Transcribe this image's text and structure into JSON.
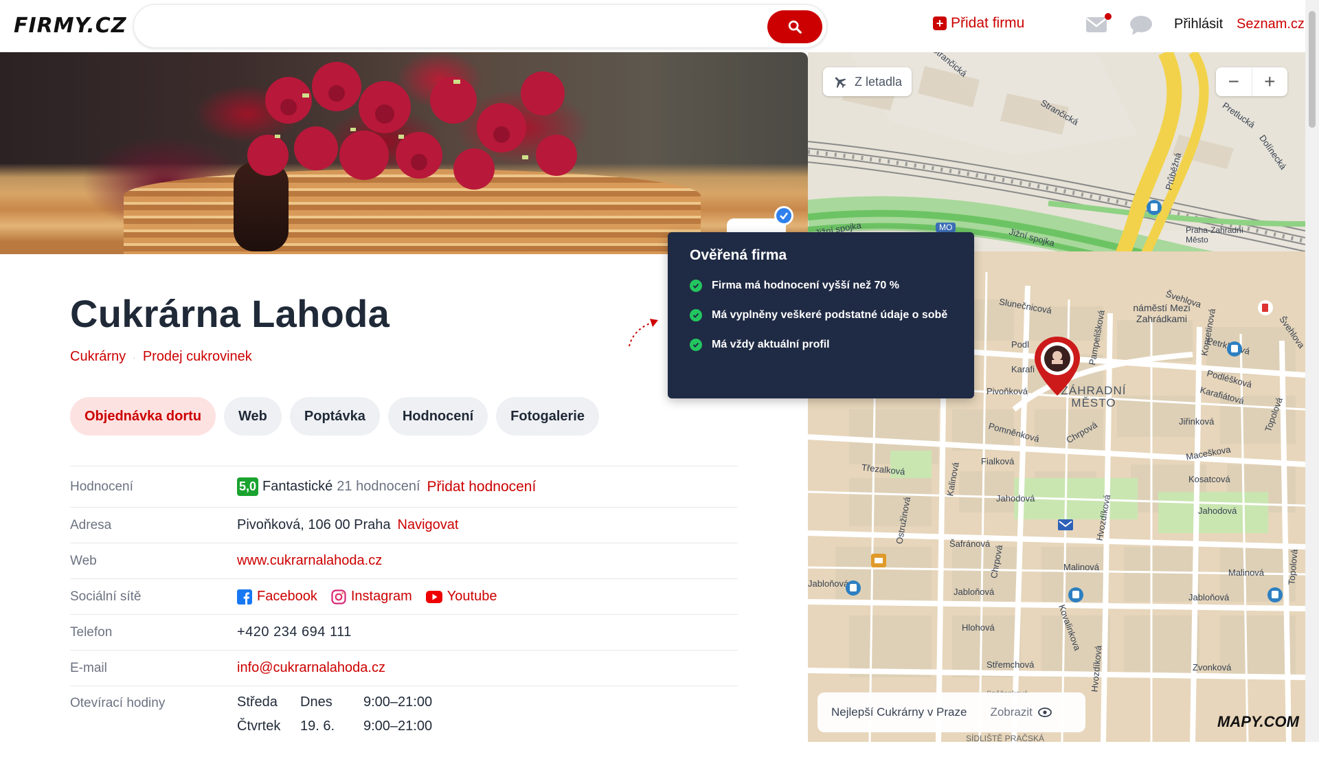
{
  "header": {
    "logo": "FIRMY.CZ",
    "search_placeholder": "",
    "add_firm": "Přidat firmu",
    "login": "Přihlásit",
    "seznam": "Seznam.cz"
  },
  "company": {
    "name": "Cukrárna Lahoda",
    "categories": [
      "Cukrárny",
      "Prodej cukrovinek"
    ]
  },
  "chips": [
    "Objednávka dortu",
    "Web",
    "Poptávka",
    "Hodnocení",
    "Fotogalerie"
  ],
  "info": {
    "rating_label": "Hodnocení",
    "rating_score": "5,0",
    "rating_word": "Fantastické",
    "rating_count": "21 hodnocení",
    "rating_add": "Přidat hodnocení",
    "address_label": "Adresa",
    "address": "Pivoňková, 106 00 Praha",
    "navigate": "Navigovat",
    "web_label": "Web",
    "web": "www.cukrarnalahoda.cz",
    "social_label": "Sociální sítě",
    "facebook": "Facebook",
    "instagram": "Instagram",
    "youtube": "Youtube",
    "phone_label": "Telefon",
    "phone": "+420 234 694 111",
    "email_label": "E-mail",
    "email": "info@cukrarnalahoda.cz",
    "hours_label": "Otevírací hodiny",
    "hours": [
      {
        "day": "Středa",
        "when": "Dnes",
        "time": "9:00–21:00"
      },
      {
        "day": "Čtvrtek",
        "when": "19. 6.",
        "time": "9:00–21:00"
      }
    ]
  },
  "tooltip": {
    "title": "Ověřená firma",
    "items": [
      "Firma má hodnocení vyšší než 70 %",
      "Má vyplněny veškeré podstatné údaje o sobě",
      "Má vždy aktuální profil"
    ]
  },
  "map": {
    "aerial_button": "Z letadla",
    "zoom_out": "−",
    "zoom_in": "+",
    "bottom_title": "Nejlepší Cukrárny v Praze",
    "bottom_show": "Zobrazit",
    "district": "ZÁHRADNÍ MĚSTO",
    "district_line1": "ZÁHRADNÍ",
    "district_line2": "MĚSTO",
    "logo": "MAPY.COM",
    "streets": [
      "Strančická",
      "Strančická",
      "Pretlucká",
      "Dolínecká",
      "Průběžná",
      "Jižní spojka",
      "Jižní spojka",
      "MO",
      "Praha-Zahradní Město",
      "Slunečnicová",
      "Pampelišková",
      "náměstí Mezi Zahrádkami",
      "Švehlova",
      "Švehlova",
      "Petrklíčová",
      "Podléšková",
      "Karafiátová",
      "Kopretinová",
      "Pivoňková",
      "Pomněnková",
      "Chrpová",
      "Jiřinková",
      "Topolová",
      "Maceškova",
      "Třezalková",
      "Fialková",
      "Kosatcová",
      "Kalinová",
      "Jahodová",
      "Jahodová",
      "Ostružinová",
      "Šafránová",
      "Chrpová",
      "Hvozdíková",
      "Malinová",
      "Malinová",
      "Jabloňová",
      "Jabloňová",
      "Jabloňová",
      "Hlohová",
      "Kovalinkova",
      "Střemchová",
      "Zvonková",
      "Hvozdíková",
      "Topolová",
      "Sněženková",
      "SÍDLIŠTĚ PRAČSKÁ",
      "Podl",
      "Karafi"
    ]
  }
}
